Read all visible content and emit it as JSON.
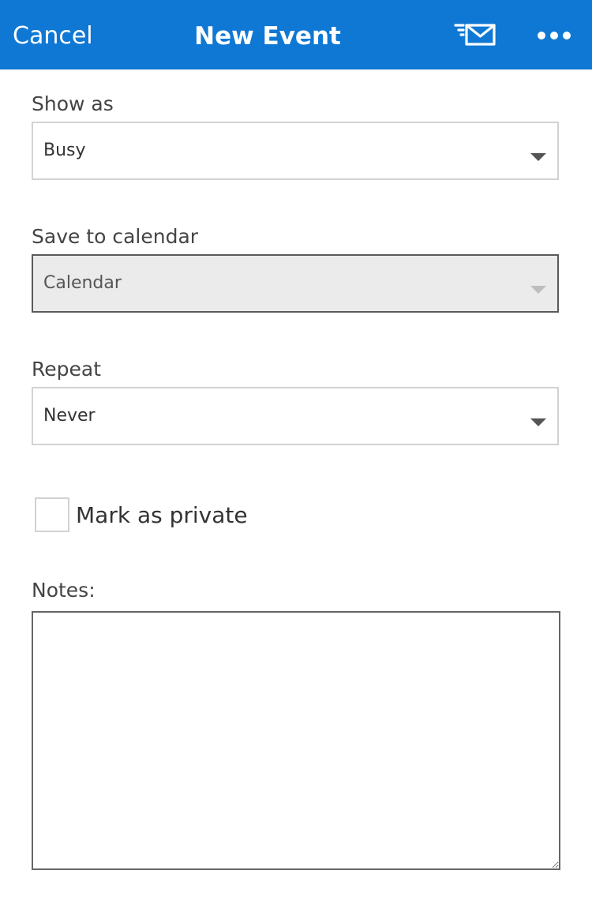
{
  "header": {
    "cancel_label": "Cancel",
    "title": "New Event",
    "send_icon": "send-mail-icon",
    "more_icon": "more-horizontal-icon",
    "accent_color": "#0f78d4"
  },
  "show_as": {
    "label": "Show as",
    "value": "Busy"
  },
  "save_to_calendar": {
    "label": "Save to calendar",
    "value": "Calendar",
    "disabled": true
  },
  "repeat": {
    "label": "Repeat",
    "value": "Never"
  },
  "private": {
    "label": "Mark as private",
    "checked": false
  },
  "notes": {
    "label": "Notes:",
    "value": ""
  }
}
